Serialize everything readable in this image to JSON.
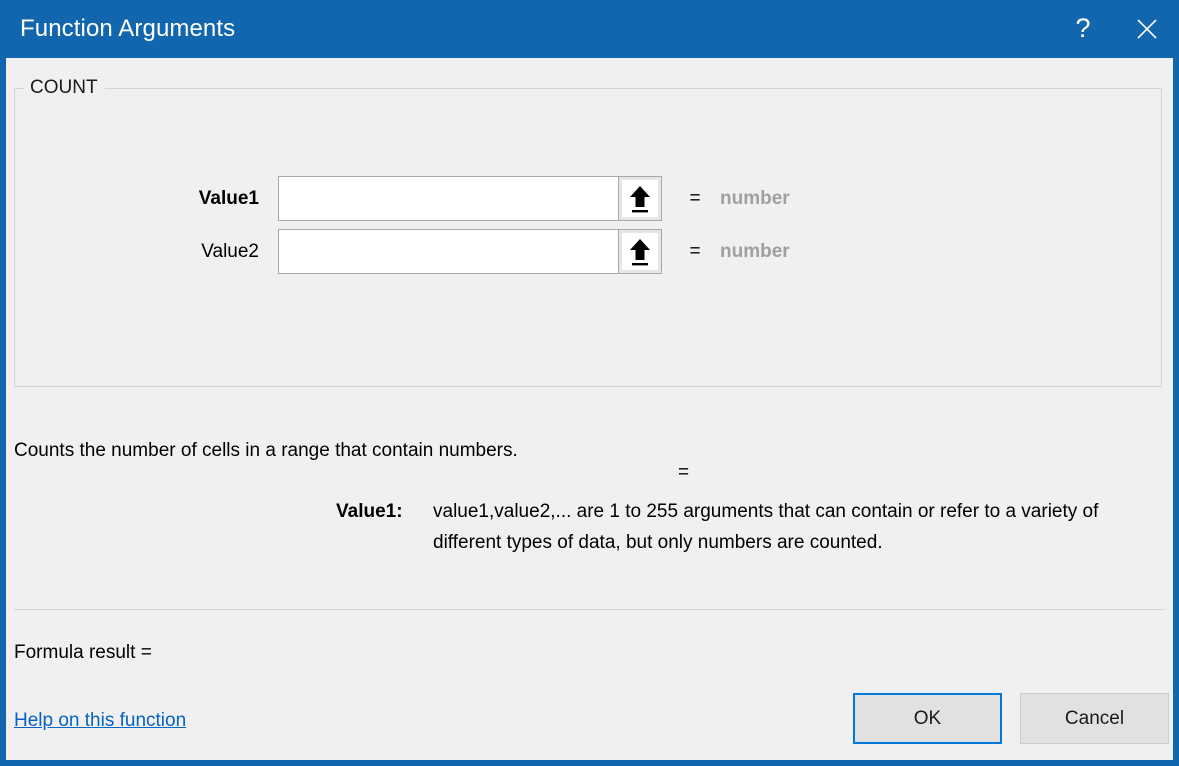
{
  "window": {
    "title": "Function Arguments",
    "help_button": "?",
    "close_button": "×"
  },
  "function": {
    "name": "COUNT",
    "description": "Counts the number of cells in a range that contain numbers.",
    "result_equals": "=",
    "argument_help": {
      "term": "Value1:",
      "text": "value1,value2,... are 1 to 255 arguments that can contain or refer to a variety of different types of data, but only numbers are counted."
    }
  },
  "arguments": [
    {
      "label": "Value1",
      "value": "",
      "placeholder": "",
      "equals": "=",
      "type_hint": "number",
      "active": true,
      "collapse_icon": "collapse-dialog-icon"
    },
    {
      "label": "Value2",
      "value": "",
      "placeholder": "",
      "equals": "=",
      "type_hint": "number",
      "active": false,
      "collapse_icon": "collapse-dialog-icon"
    }
  ],
  "footer": {
    "formula_result_label": "Formula result =",
    "help_link": "Help on this function",
    "ok_button": "OK",
    "cancel_button": "Cancel"
  },
  "colors": {
    "titlebar": "#1266ad",
    "dialog_background": "#f0f0f0",
    "link": "#0563c1",
    "hint_text": "#a0a0a0",
    "focus_border": "#0078d7"
  }
}
